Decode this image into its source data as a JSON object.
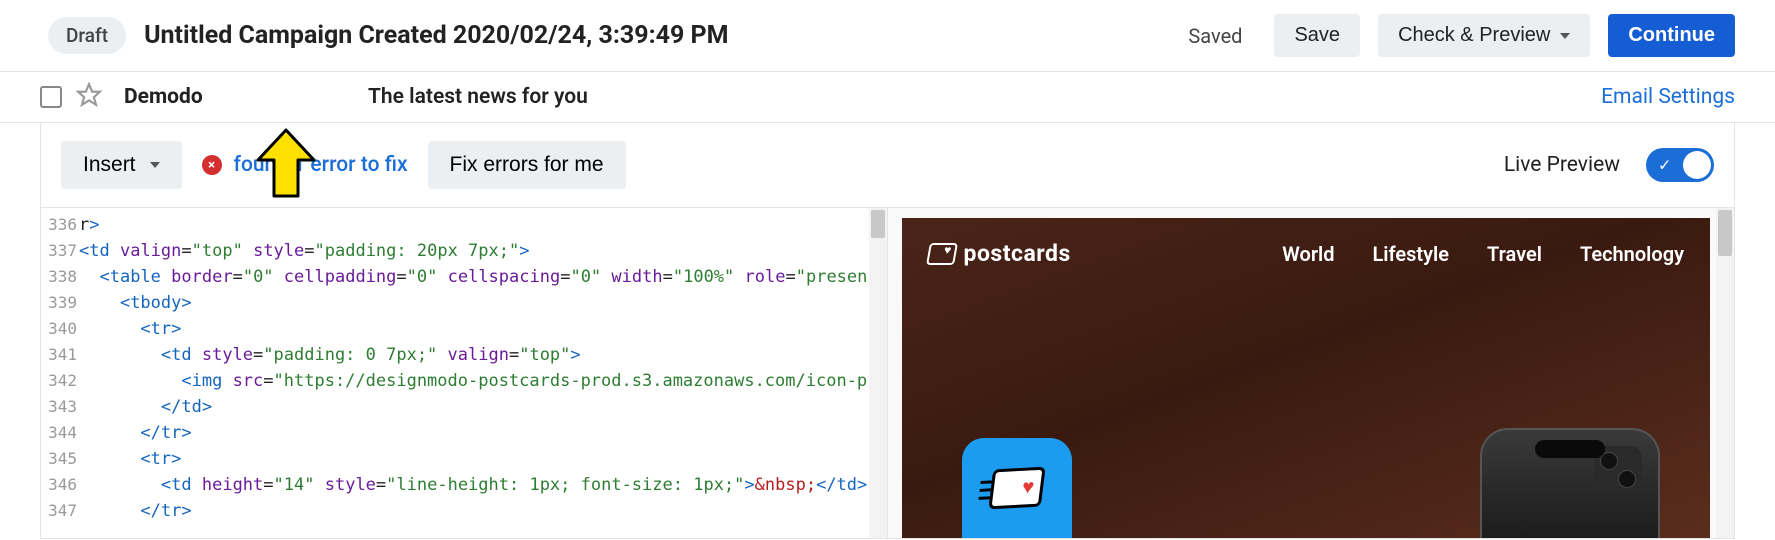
{
  "header": {
    "draft_label": "Draft",
    "title": "Untitled Campaign Created 2020/02/24, 3:39:49 PM",
    "saved_label": "Saved",
    "save_label": "Save",
    "check_preview_label": "Check & Preview",
    "continue_label": "Continue"
  },
  "row2": {
    "sender": "Demodo",
    "subject": "The latest news for you",
    "email_settings": "Email Settings"
  },
  "toolbar": {
    "insert_label": "Insert",
    "error_badge": "×",
    "error_text": "found 1 error to fix",
    "fix_label": "Fix errors for me",
    "live_preview_label": "Live Preview"
  },
  "code": {
    "lines": [
      {
        "no": "336",
        "html": "r<span class='tag'>&gt;</span>"
      },
      {
        "no": "337",
        "html": "<span class='tag'>&lt;td</span> <span class='attr'>valign</span>=<span class='str'>\"top\"</span> <span class='attr'>style</span>=<span class='str'>\"padding: 20px 7px;\"</span><span class='tag'>&gt;</span>"
      },
      {
        "no": "338",
        "html": "  <span class='tag'>&lt;table</span> <span class='attr'>border</span>=<span class='str'>\"0\"</span> <span class='attr'>cellpadding</span>=<span class='str'>\"0\"</span> <span class='attr'>cellspacing</span>=<span class='str'>\"0\"</span> <span class='attr'>width</span>=<span class='str'>\"100%\"</span> <span class='attr'>role</span>=<span class='str'>\"presen</span>"
      },
      {
        "no": "339",
        "html": "    <span class='tag'>&lt;tbody&gt;</span>"
      },
      {
        "no": "340",
        "html": "      <span class='tag'>&lt;tr&gt;</span>"
      },
      {
        "no": "341",
        "html": "        <span class='tag'>&lt;td</span> <span class='attr'>style</span>=<span class='str'>\"padding: 0 7px;\"</span> <span class='attr'>valign</span>=<span class='str'>\"top\"</span><span class='tag'>&gt;</span>"
      },
      {
        "no": "342",
        "html": "          <span class='tag'>&lt;img</span> <span class='attr'>src</span>=<span class='str'>\"https://designmodo-postcards-prod.s3.amazonaws.com/icon-p</span>"
      },
      {
        "no": "343",
        "html": "        <span class='tag'>&lt;/td&gt;</span>"
      },
      {
        "no": "344",
        "html": "      <span class='tag'>&lt;/tr&gt;</span>"
      },
      {
        "no": "345",
        "html": "      <span class='tag'>&lt;tr&gt;</span>"
      },
      {
        "no": "346",
        "html": "        <span class='tag'>&lt;td</span> <span class='attr'>height</span>=<span class='str'>\"14\"</span> <span class='attr'>style</span>=<span class='str'>\"line-height: 1px; font-size: 1px;\"</span><span class='tag'>&gt;</span><span class='txt'>&amp;nbsp;</span><span class='tag'>&lt;/td&gt;</span>"
      },
      {
        "no": "347",
        "html": "      <span class='tag'>&lt;/tr&gt;</span>"
      }
    ]
  },
  "preview": {
    "logo_text": "postcards",
    "nav": [
      "World",
      "Lifestyle",
      "Travel",
      "Technology"
    ]
  }
}
